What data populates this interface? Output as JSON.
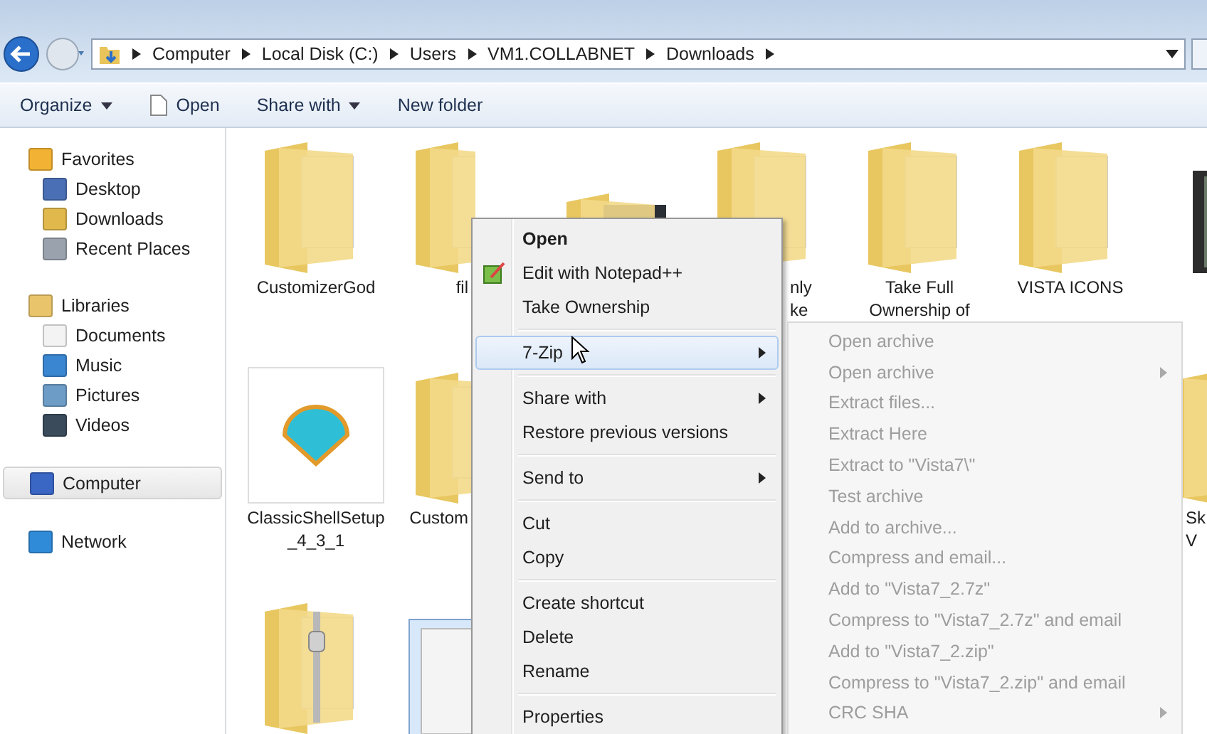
{
  "breadcrumb": [
    "Computer",
    "Local Disk (C:)",
    "Users",
    "VM1.COLLABNET",
    "Downloads"
  ],
  "toolbar": [
    {
      "label": "Organize",
      "dropdown": true,
      "icon": false
    },
    {
      "label": "Open",
      "dropdown": false,
      "icon": true
    },
    {
      "label": "Share with",
      "dropdown": true,
      "icon": false
    },
    {
      "label": "New folder",
      "dropdown": false,
      "icon": false
    }
  ],
  "sidebar": {
    "sections": [
      {
        "label": "Favorites",
        "selected": false,
        "children": [
          {
            "label": "Desktop",
            "selected": false
          },
          {
            "label": "Downloads",
            "selected": false
          },
          {
            "label": "Recent Places",
            "selected": false
          }
        ]
      },
      {
        "label": "Libraries",
        "selected": false,
        "children": [
          {
            "label": "Documents",
            "selected": false
          },
          {
            "label": "Music",
            "selected": false
          },
          {
            "label": "Pictures",
            "selected": false
          },
          {
            "label": "Videos",
            "selected": false
          }
        ]
      },
      {
        "label": "Computer",
        "selected": true
      },
      {
        "label": "Network",
        "selected": false
      }
    ]
  },
  "files": {
    "rows": [
      [
        {
          "kind": "folder",
          "label": "CustomizerGod",
          "selected": false
        },
        {
          "kind": "folder",
          "label": "fil",
          "selected": false
        },
        {
          "kind": "photo_folder",
          "selected": false
        },
        {
          "kind": "folder",
          "label": "nly\nke",
          "selected": false
        },
        {
          "kind": "folder",
          "label": "Take Full\nOwnership of",
          "selected": false
        },
        {
          "kind": "folder",
          "label": "VISTA ICONS",
          "selected": false
        },
        {
          "kind": "video",
          "selected": false
        }
      ],
      [
        {
          "kind": "app",
          "label": "ClassicShellSetup\n_4_3_1",
          "selected": false
        },
        {
          "kind": "folder",
          "label": "Custom",
          "selected": false
        },
        {
          "kind": "folder",
          "label": "Sk\nV",
          "selected": false
        }
      ],
      [
        {
          "kind": "zip",
          "selected": false
        },
        {
          "kind": "file",
          "selected": true
        }
      ]
    ]
  },
  "context_menu": {
    "groups": [
      [
        {
          "label": "Open",
          "default": true,
          "icon": false,
          "submenu": false,
          "selected": false
        },
        {
          "label": "Edit with Notepad++",
          "default": false,
          "icon": true,
          "submenu": false,
          "selected": false
        },
        {
          "label": "Take Ownership",
          "default": false,
          "icon": false,
          "submenu": false,
          "selected": false
        }
      ],
      [
        {
          "label": "7-Zip",
          "default": false,
          "icon": false,
          "submenu": true,
          "selected": true
        }
      ],
      [
        {
          "label": "Share with",
          "default": false,
          "icon": false,
          "submenu": true,
          "selected": false
        },
        {
          "label": "Restore previous versions",
          "default": false,
          "icon": false,
          "submenu": false,
          "selected": false
        }
      ],
      [
        {
          "label": "Send to",
          "default": false,
          "icon": false,
          "submenu": true,
          "selected": false
        }
      ],
      [
        {
          "label": "Cut",
          "default": false,
          "icon": false,
          "submenu": false,
          "selected": false
        },
        {
          "label": "Copy",
          "default": false,
          "icon": false,
          "submenu": false,
          "selected": false
        }
      ],
      [
        {
          "label": "Create shortcut",
          "default": false,
          "icon": false,
          "submenu": false,
          "selected": false
        },
        {
          "label": "Delete",
          "default": false,
          "icon": false,
          "submenu": false,
          "selected": false
        },
        {
          "label": "Rename",
          "default": false,
          "icon": false,
          "submenu": false,
          "selected": false
        }
      ],
      [
        {
          "label": "Properties",
          "default": false,
          "icon": false,
          "submenu": false,
          "selected": false
        }
      ]
    ]
  },
  "submenu": {
    "items": [
      {
        "label": "Open archive",
        "submenu": false,
        "disabled": true
      },
      {
        "label": "Open archive",
        "submenu": true,
        "disabled": true
      },
      {
        "label": "Extract files...",
        "submenu": false,
        "disabled": true
      },
      {
        "label": "Extract Here",
        "submenu": false,
        "disabled": true
      },
      {
        "label": "Extract to \"Vista7\\\"",
        "submenu": false,
        "disabled": true
      },
      {
        "label": "Test archive",
        "submenu": false,
        "disabled": true
      },
      {
        "label": "Add to archive...",
        "submenu": false,
        "disabled": true
      },
      {
        "label": "Compress and email...",
        "submenu": false,
        "disabled": true
      },
      {
        "label": "Add to \"Vista7_2.7z\"",
        "submenu": false,
        "disabled": true
      },
      {
        "label": "Compress to \"Vista7_2.7z\" and email",
        "submenu": false,
        "disabled": true
      },
      {
        "label": "Add to \"Vista7_2.zip\"",
        "submenu": false,
        "disabled": true
      },
      {
        "label": "Compress to \"Vista7_2.zip\" and email",
        "submenu": false,
        "disabled": true
      },
      {
        "label": "CRC SHA",
        "submenu": true,
        "disabled": true
      }
    ]
  }
}
